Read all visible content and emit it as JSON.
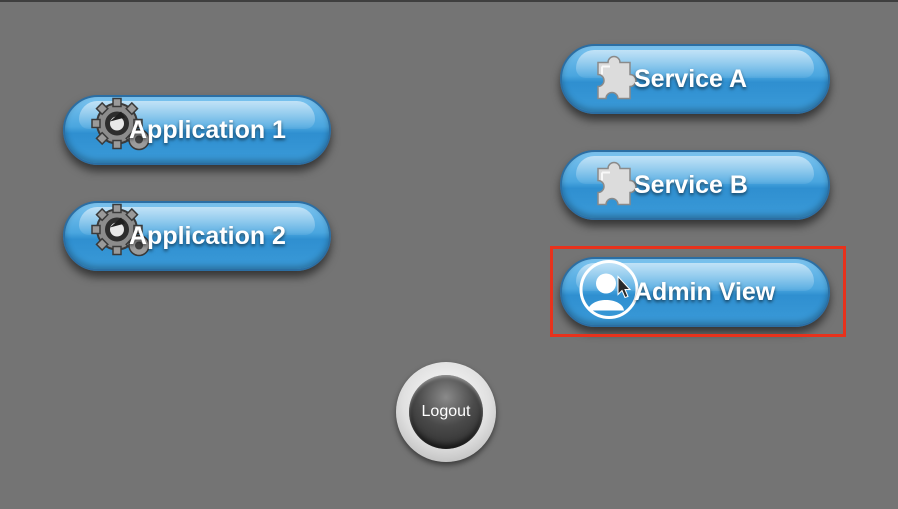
{
  "left_buttons": [
    {
      "label": "Application 1",
      "icon": "gear-icon"
    },
    {
      "label": "Application 2",
      "icon": "gear-icon"
    }
  ],
  "right_buttons": [
    {
      "label": "Service A",
      "icon": "puzzle-piece-icon"
    },
    {
      "label": "Service B",
      "icon": "puzzle-piece-icon"
    },
    {
      "label": "Admin View",
      "icon": "admin-user-icon"
    }
  ],
  "logout": {
    "label": "Logout"
  },
  "colors": {
    "background": "#747474",
    "button_blue": "#4aa6df",
    "highlight_red": "#e8321c",
    "text": "#ffffff"
  }
}
